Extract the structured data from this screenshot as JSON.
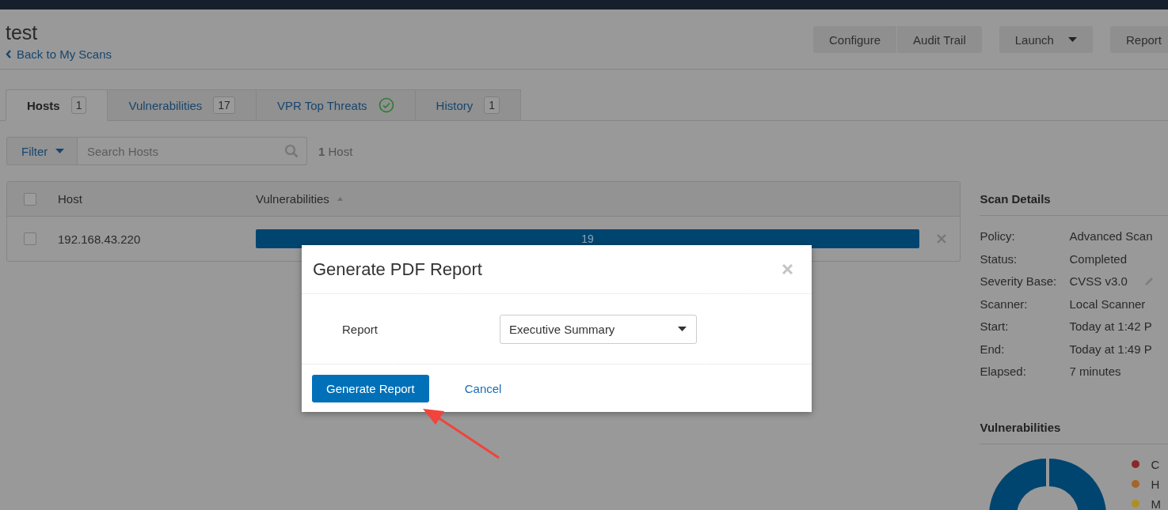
{
  "page": {
    "title": "test",
    "back_link": "Back to My Scans"
  },
  "toolbar": [
    [
      {
        "label": "Configure",
        "kind": "plain"
      },
      {
        "label": "Audit Trail",
        "kind": "plain"
      }
    ],
    [
      {
        "label": "Launch",
        "kind": "dropdown"
      }
    ],
    [
      {
        "label": "Report",
        "kind": "plain"
      }
    ]
  ],
  "tabs": [
    {
      "label": "Hosts",
      "count": "1",
      "kind": "count",
      "selected": true
    },
    {
      "label": "Vulnerabilities",
      "count": "17",
      "kind": "count",
      "selected": false
    },
    {
      "label": "VPR Top Threats",
      "kind": "check",
      "selected": false
    },
    {
      "label": "History",
      "count": "1",
      "kind": "count",
      "selected": false
    }
  ],
  "filter": {
    "button": "Filter",
    "search_placeholder": "Search Hosts",
    "result_count": "**1** Host"
  },
  "hosts_table": {
    "header_checked": false,
    "columns": [
      {
        "label": "Host",
        "sorted": false
      },
      {
        "label": "Vulnerabilities",
        "sorted": true
      }
    ],
    "rows": [
      {
        "host": "192.168.43.220",
        "checked": false,
        "vulnerabilities": "19"
      }
    ]
  },
  "scan_details": {
    "title": "Scan Details",
    "rows": [
      {
        "label": "Policy:",
        "value": "Advanced Scan",
        "editable": false
      },
      {
        "label": "Status:",
        "value": "Completed",
        "editable": false
      },
      {
        "label": "Severity Base:",
        "value": "CVSS v3.0",
        "editable": true
      },
      {
        "label": "Scanner:",
        "value": "Local Scanner",
        "editable": false
      },
      {
        "label": "Start:",
        "value": "Today at 1:42 P",
        "editable": false
      },
      {
        "label": "End:",
        "value": "Today at 1:49 P",
        "editable": false
      },
      {
        "label": "Elapsed:",
        "value": "7 minutes",
        "editable": false
      }
    ]
  },
  "vulnerabilities_panel": {
    "title": "Vulnerabilities",
    "legend": [
      {
        "label": "C",
        "color": "#8a2828"
      },
      {
        "label": "H",
        "color": "#a5652a"
      },
      {
        "label": "M",
        "color": "#b08e24"
      }
    ]
  },
  "dialog": {
    "title": "Generate PDF Report",
    "field_label": "Report",
    "select_value": "Executive Summary",
    "primary_button": "Generate Report",
    "cancel_link": "Cancel"
  }
}
